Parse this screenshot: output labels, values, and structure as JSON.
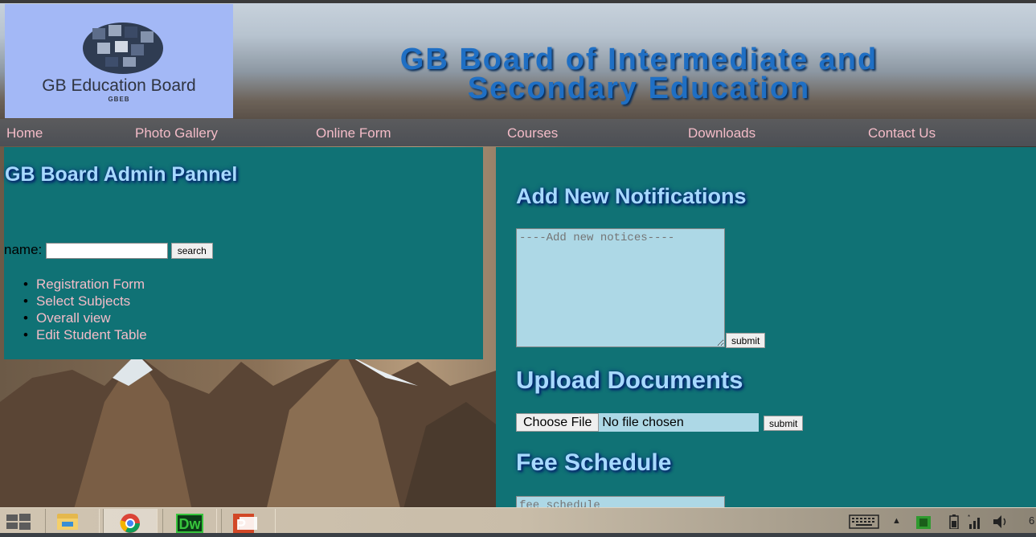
{
  "header": {
    "logo_text": "GB Education Board",
    "logo_sub": "GBEB",
    "title_line1": "GB Board of Intermediate and",
    "title_line2": "Secondary Education"
  },
  "nav": {
    "items": [
      "Home",
      "Photo Gallery",
      "Online Form",
      "Courses",
      "Downloads",
      "Contact Us"
    ]
  },
  "left": {
    "title": "GB Board Admin Pannel",
    "search_label": "name:",
    "search_button": "search",
    "links": [
      "Registration Form",
      "Select Subjects",
      "Overall view",
      "Edit Student Table"
    ]
  },
  "right": {
    "notifications_title": "Add New Notifications",
    "notice_placeholder": "----Add new notices----",
    "submit_label": "submit",
    "upload_title": "Upload Documents",
    "choose_file_label": "Choose File",
    "no_file_label": "No file chosen",
    "fee_title": "Fee Schedule",
    "fee_placeholder": "fee schedule"
  },
  "taskbar": {
    "apps": [
      "file-explorer-icon",
      "chrome-icon",
      "dreamweaver-icon",
      "powerpoint-icon"
    ],
    "dw_label": "Dw",
    "clock_partial": "6"
  },
  "colors": {
    "panel": "#107275",
    "link": "#f4bcc8",
    "heading": "#a7d9ff",
    "input_bg": "#add8e6"
  }
}
